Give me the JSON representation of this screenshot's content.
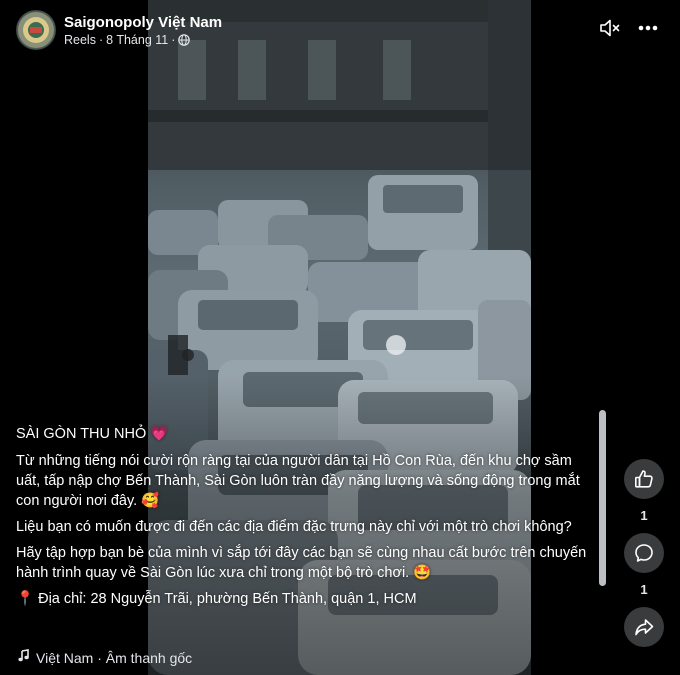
{
  "header": {
    "page_name": "Saigonopoly Việt Nam",
    "meta_type": "Reels",
    "meta_date": "8 Tháng 11",
    "meta_separator": "·",
    "privacy_icon": "globe-icon"
  },
  "controls": {
    "mute_icon": "speaker-muted-icon",
    "more_icon": "more-horizontal-icon"
  },
  "caption": {
    "title": "SÀI GÒN THU NHỎ",
    "title_emoji": "💗",
    "paragraph_1": "Từ những tiếng nói cười rộn ràng tại của  người dân tại Hồ Con Rùa, đến khu chợ sầm uất, tấp nập chợ Bến Thành, Sài Gòn luôn tràn đầy năng lượng và sống động trong mắt con người nơi đây.",
    "paragraph_1_emoji": "🥰",
    "paragraph_2": "Liệu bạn có muốn được đi đến các địa điểm đặc trưng này chỉ với một trò chơi không?",
    "paragraph_3": "Hãy tập hợp bạn bè của mình vì sắp tới đây các bạn sẽ cùng nhau cất bước trên chuyến hành trình quay về Sài Gòn lúc xưa chỉ trong một bộ trò chơi.",
    "paragraph_3_emoji": "🤩",
    "address_emoji": "📍",
    "address": "Địa chỉ: 28 Nguyễn Trãi, phường Bến Thành, quận 1, HCM"
  },
  "audio": {
    "icon": "music-note-icon",
    "label": "Việt Nam · Âm thanh gốc"
  },
  "actions": {
    "like_icon": "thumbs-up-icon",
    "like_count": "1",
    "comment_icon": "comment-icon",
    "comment_count": "1",
    "share_icon": "share-icon"
  },
  "colors": {
    "background": "#000000",
    "button_bg": "#3a3b3c",
    "text_secondary": "#e4e6eb"
  }
}
